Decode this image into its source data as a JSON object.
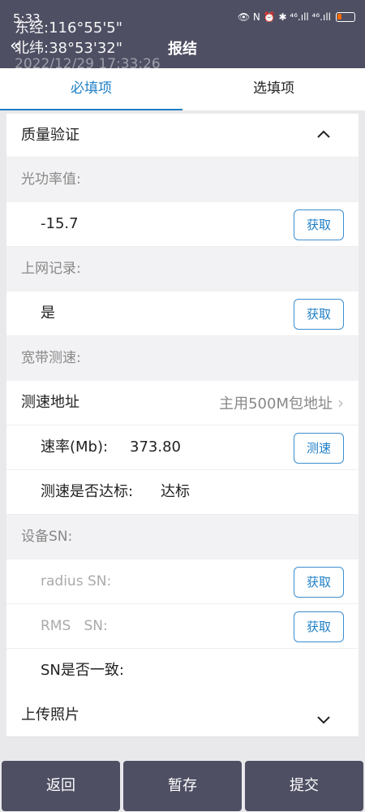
{
  "status": {
    "time": "5:33",
    "icons": "👁 N ⏰ ✱ ⁴⁶.ıll ⁴⁶.ıll"
  },
  "geo": {
    "longitude": "东经:116°55'5\"",
    "latitude": "北纬:38°53'32\"",
    "timestamp": "2022/12/29 17:33:26"
  },
  "header": {
    "title": "报结"
  },
  "tabs": [
    {
      "label": "必填项"
    },
    {
      "label": "选填项"
    }
  ],
  "sections": {
    "quality": {
      "title": "质量验证",
      "caret": "^"
    },
    "optical_power": {
      "label": "光功率值:",
      "value": "-15.7",
      "button": "获取"
    },
    "online_record": {
      "label": "上网记录:",
      "value": "是",
      "button": "获取"
    },
    "broadband": {
      "label": "宽带测速:"
    },
    "speed_address": {
      "label": "测速地址",
      "value": "主用500M包地址",
      "chevron": "›"
    },
    "rate": {
      "label": "速率(Mb):",
      "value": "373.80",
      "button": "测速"
    },
    "speed_pass": {
      "label": "测速是否达标:",
      "value": "达标"
    },
    "device_sn": {
      "label": "设备SN:"
    },
    "radius_sn": {
      "label": "radius SN:",
      "button": "获取"
    },
    "rms_sn": {
      "label": "RMS   SN:",
      "button": "获取"
    },
    "sn_consistent": {
      "label": "SN是否一致:"
    },
    "upload_photo": {
      "title": "上传照片",
      "caret": "∨"
    }
  },
  "bottom": {
    "back": "返回",
    "save": "暂存",
    "submit": "提交"
  },
  "colors": {
    "header_bg": "#4e4f63",
    "accent": "#1e7fc7",
    "battery": "#ff6a00"
  }
}
